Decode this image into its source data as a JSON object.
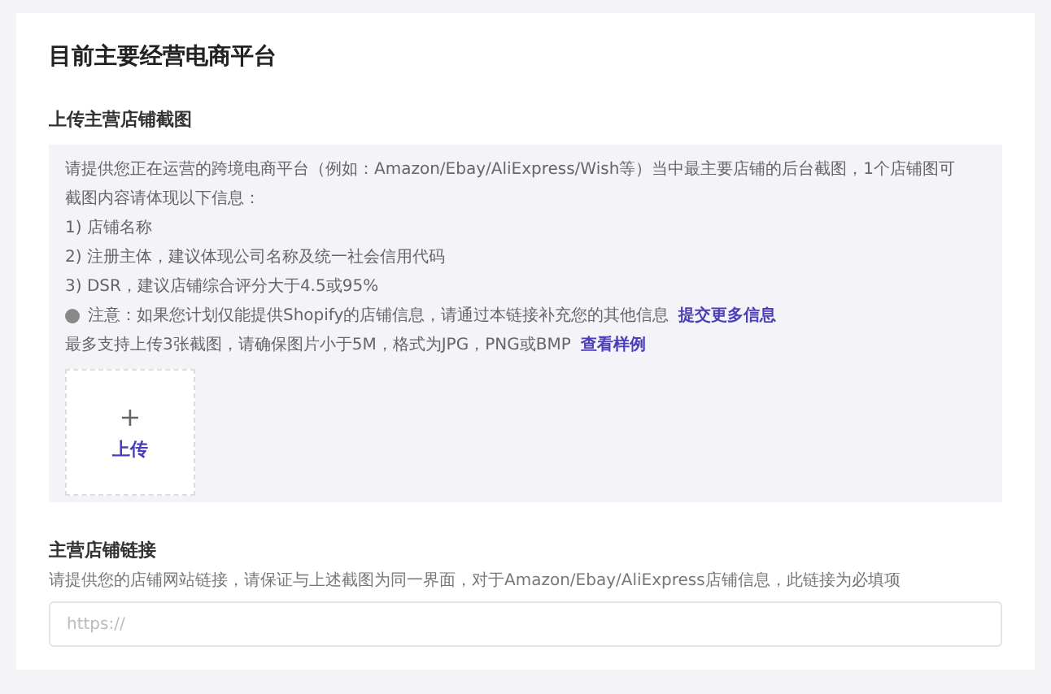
{
  "title": "目前主要经营电商平台",
  "upload_section": {
    "heading": "上传主营店铺截图",
    "lines": [
      {
        "kind": "text",
        "text": "请提供您正在运营的跨境电商平台（例如：Amazon/Ebay/AliExpress/Wish等）当中最主要店铺的后台截图，1个店铺图可"
      },
      {
        "kind": "text",
        "text": "截图内容请体现以下信息："
      },
      {
        "kind": "text",
        "text": "1) 店铺名称"
      },
      {
        "kind": "text",
        "text": "2) 注册主体，建议体现公司名称及统一社会信用代码"
      },
      {
        "kind": "text",
        "text": "3) DSR，建议店铺综合评分大于4.5或95%"
      },
      {
        "kind": "notice",
        "text": "注意：如果您计划仅能提供Shopify的店铺信息，请通过本链接补充您的其他信息",
        "link": "提交更多信息"
      },
      {
        "kind": "text",
        "text": "最多支持上传3张截图，请确保图片小于5M，格式为JPG，PNG或BMP",
        "link": "查看样例"
      }
    ],
    "upload_button": {
      "icon": "+",
      "label": "上传"
    }
  },
  "link_section": {
    "heading": "主营店铺链接",
    "description": "请提供您的店铺网站链接，请保证与上述截图为同一界面，对于Amazon/Ebay/AliExpress店铺信息，此链接为必填项",
    "placeholder": "https://"
  }
}
